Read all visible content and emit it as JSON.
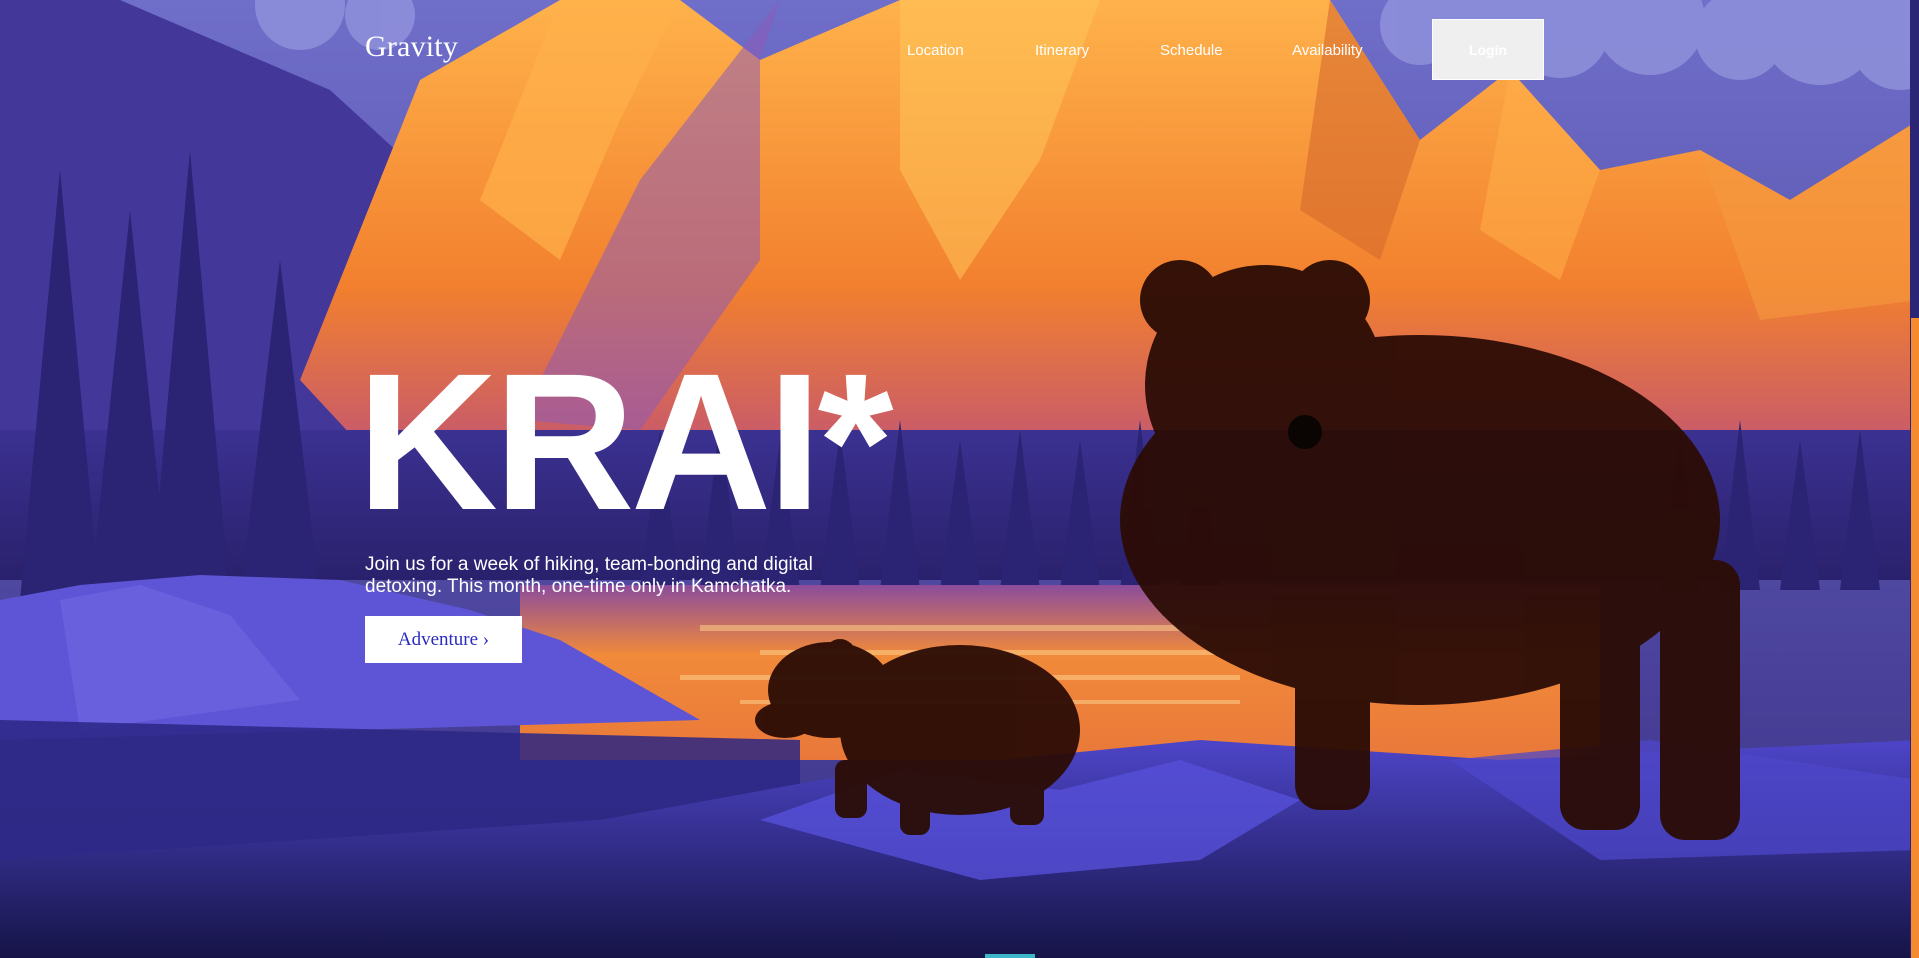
{
  "nav": {
    "logo": "Gravity",
    "items": [
      "Location",
      "Itinerary",
      "Schedule",
      "Availability"
    ],
    "login_label": "Login"
  },
  "hero": {
    "title": "KRAI*",
    "subtitle": "Join us for a week of hiking, team-bonding and digital detoxing. This month, one-time only in Kamchatka.",
    "cta_label": "Adventure ›"
  },
  "colors": {
    "sky": "#5a58b8",
    "mountain_orange": "#f58a2e",
    "forest_purple": "#3a2f86",
    "lake": "#e9783a",
    "bear": "#2b0c05",
    "cta_text": "#2a2bc0"
  }
}
